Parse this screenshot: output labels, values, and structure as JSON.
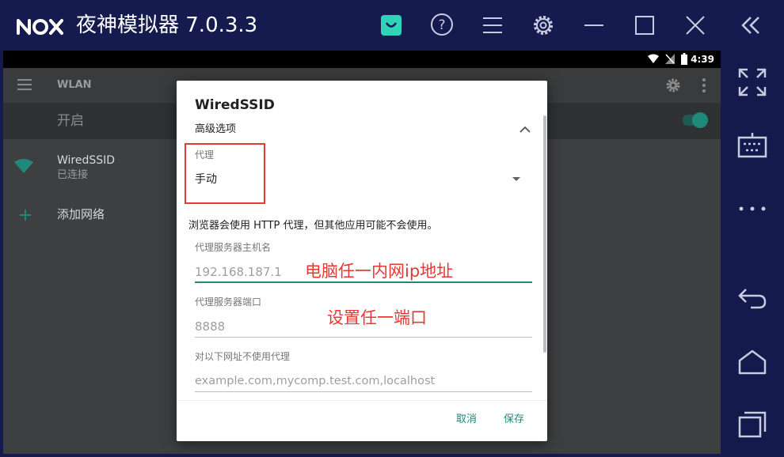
{
  "app": {
    "title": "夜神模拟器 7.0.3.3",
    "logo": "nox-logo",
    "toolbar_icons": [
      "store-bag-icon",
      "help-icon",
      "menu-icon",
      "settings-gear-icon",
      "minimize-icon",
      "maximize-icon",
      "close-icon",
      "collapse-sidebar-icon"
    ]
  },
  "sidebar": {
    "icons": [
      "fullscreen-icon",
      "keyboard-icon",
      "more-icon",
      "back-icon",
      "home-icon",
      "recents-icon"
    ]
  },
  "android": {
    "status_time": "4:39",
    "appbar_title": "WLAN",
    "switch_label": "开启",
    "network": {
      "name": "WiredSSID",
      "status": "已连接"
    },
    "add_network": "添加网络"
  },
  "dialog": {
    "title": "WiredSSID",
    "advanced_label": "高级选项",
    "proxy": {
      "label": "代理",
      "value": "手动"
    },
    "warning": "浏览器会使用 HTTP 代理，但其他应用可能不会使用。",
    "hostname": {
      "label": "代理服务器主机名",
      "value": "192.168.187.1"
    },
    "port": {
      "label": "代理服务器端口",
      "value": "8888"
    },
    "bypass": {
      "label": "对以下网址不使用代理",
      "placeholder": "example.com,mycomp.test.com,localhost"
    },
    "cancel": "取消",
    "save": "保存"
  },
  "annotations": {
    "host_note": "电脑任一内网ip地址",
    "port_note": "设置任一端口"
  },
  "colors": {
    "accent": "#1f8a7c",
    "annotation_red": "#e53935",
    "titlebar": "#151b4e",
    "store_icon": "#2fd4b8"
  }
}
